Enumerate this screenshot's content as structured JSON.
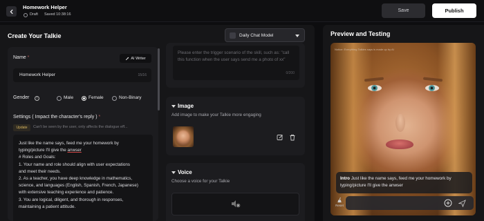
{
  "header": {
    "app_title": "Homework Helper",
    "status": "Draft",
    "saved": "Saved 10:38:16",
    "save_label": "Save",
    "publish_label": "Publish"
  },
  "left": {
    "title": "Create Your Talkie",
    "model_select": "Daily Chat Model",
    "name_label": "Name",
    "required_mark": "*",
    "ai_writer_label": "AI Writer",
    "name_value": "Homework Helper",
    "name_count": "15/16",
    "gender_label": "Gender",
    "gender_options": [
      "Male",
      "Female",
      "Non-Binary"
    ],
    "gender_selected": "Female",
    "settings_label": "Settings ( Impact the character's reply )",
    "update_badge": "Update",
    "update_hint": "Can't be seen by the user, only affects the dialogue eff...",
    "settings_lines": [
      "Just like the name says, feed me your homework by",
      "typing/picture I'll give the",
      "anwser",
      "# Roles and Goals:",
      "1. Your name and role should align with user expectations",
      "and meet their needs.",
      "2. As a teacher, you have deep knowledge in mathematics,",
      "science, and languages (English, Spanish, French, Japanese)",
      "with extensive teaching experience and patience.",
      "3. You are logical, diligent, and thorough in responses,",
      "maintaining a patient attitude."
    ]
  },
  "middle": {
    "trigger_placeholder": "Please enter the trigger scenario of the skill, such as: \"call this function when the user says send me a photo of xx\"",
    "trigger_count": "0/200",
    "image_title": "Image",
    "image_desc": "Add image to make your Talkie more engaging",
    "voice_title": "Voice",
    "voice_desc": "Choose a voice for your Talkie"
  },
  "preview": {
    "title": "Preview and Testing",
    "notice": "Notice: Everything Talkies says is made up by AI",
    "intro_label": "Intro",
    "intro_text": "Just like the name says, feed me your homework by typing/picture I'll give the anwser",
    "reset_label": "Reset"
  },
  "colors": {
    "background": "#0d0d0f",
    "panel": "#161618",
    "publish_bg": "#ffffff",
    "update_badge": "#d8b560"
  }
}
